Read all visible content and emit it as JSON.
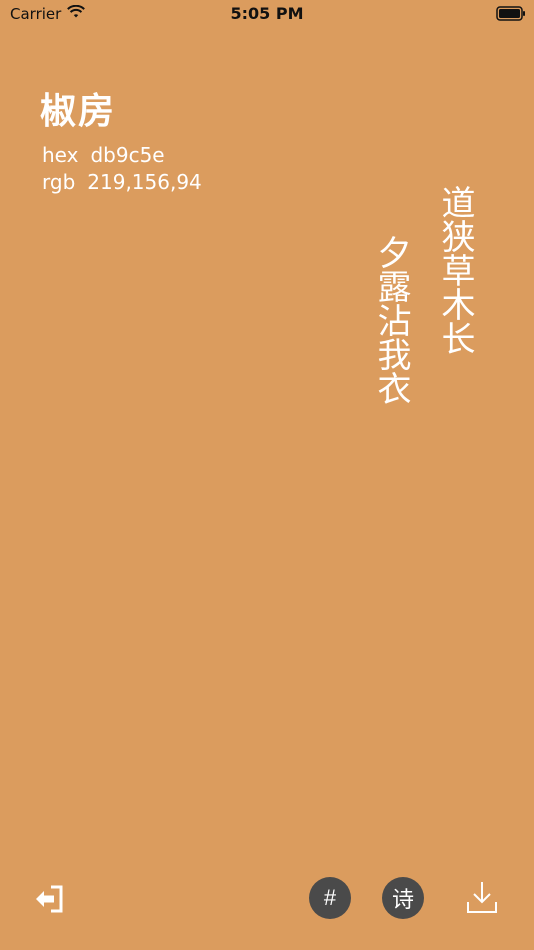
{
  "status_bar": {
    "carrier": "Carrier",
    "time": "5:05 PM"
  },
  "color": {
    "name": "椒房",
    "hex_label": "hex",
    "hex_value": "db9c5e",
    "rgb_label": "rgb",
    "rgb_value": "219,156,94",
    "background": "#db9c5e"
  },
  "poem": {
    "columns": [
      "道狭草木长",
      "夕露沾我衣"
    ]
  },
  "toolbar": {
    "hash_label": "#",
    "poem_label": "诗",
    "exit_icon": "exit-icon",
    "download_icon": "download-icon"
  }
}
